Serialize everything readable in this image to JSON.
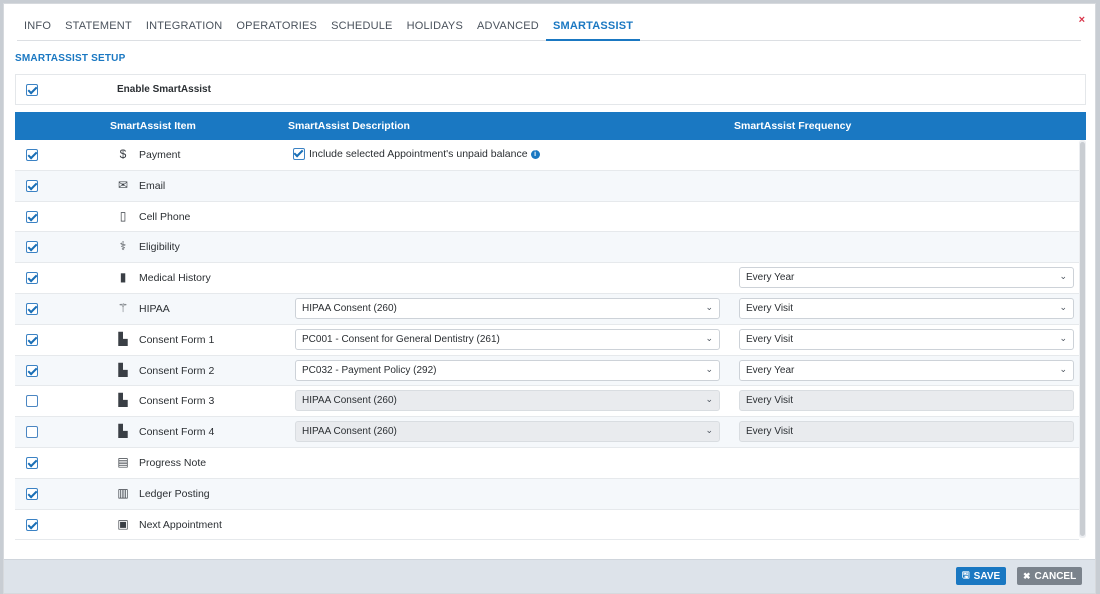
{
  "tabs": [
    "INFO",
    "STATEMENT",
    "INTEGRATION",
    "OPERATORIES",
    "SCHEDULE",
    "HOLIDAYS",
    "ADVANCED",
    "SMARTASSIST"
  ],
  "active_tab": "SMARTASSIST",
  "close_label": "×",
  "section_title": "SMARTASSIST SETUP",
  "enable": {
    "label": "Enable SmartAssist",
    "checked": true
  },
  "table_header": {
    "item": "SmartAssist Item",
    "description": "SmartAssist Description",
    "frequency": "SmartAssist Frequency"
  },
  "rows": [
    {
      "checked": true,
      "icon": "dollar-icon",
      "glyph": "$",
      "label": "Payment",
      "desc_check": {
        "label": "Include selected Appointment's unpaid balance",
        "checked": true
      }
    },
    {
      "checked": true,
      "icon": "envelope-icon",
      "glyph": "✉",
      "label": "Email"
    },
    {
      "checked": true,
      "icon": "mobile-phone-icon",
      "glyph": "▯",
      "label": "Cell Phone"
    },
    {
      "checked": true,
      "icon": "tooth-icon",
      "glyph": "⚕",
      "label": "Eligibility"
    },
    {
      "checked": true,
      "icon": "file-icon",
      "glyph": "▮",
      "label": "Medical History",
      "freq": "Every Year"
    },
    {
      "checked": true,
      "icon": "caduceus-icon",
      "glyph": "⚚",
      "label": "HIPAA",
      "desc": "HIPAA Consent (260)",
      "freq": "Every Visit"
    },
    {
      "checked": true,
      "icon": "form-icon",
      "glyph": "▙",
      "label": "Consent Form 1",
      "desc": "PC001 - Consent for General Dentistry (261)",
      "freq": "Every Visit"
    },
    {
      "checked": true,
      "icon": "form-icon",
      "glyph": "▙",
      "label": "Consent Form 2",
      "desc": "PC032 - Payment Policy (292)",
      "freq": "Every Year"
    },
    {
      "checked": false,
      "icon": "form-icon",
      "glyph": "▙",
      "label": "Consent Form 3",
      "desc": "HIPAA Consent (260)",
      "freq": "Every Visit",
      "disabled": true
    },
    {
      "checked": false,
      "icon": "form-icon",
      "glyph": "▙",
      "label": "Consent Form 4",
      "desc": "HIPAA Consent (260)",
      "freq": "Every Visit",
      "disabled": true
    },
    {
      "checked": true,
      "icon": "note-icon",
      "glyph": "▤",
      "label": "Progress Note"
    },
    {
      "checked": true,
      "icon": "ledger-icon",
      "glyph": "▥",
      "label": "Ledger Posting"
    },
    {
      "checked": true,
      "icon": "calendar-icon",
      "glyph": "▣",
      "label": "Next Appointment"
    }
  ],
  "footer": {
    "save_label": "SAVE",
    "cancel_label": "CANCEL"
  },
  "colors": {
    "accent": "#1a78c2",
    "close": "#d9344a",
    "cancel": "#7b838c"
  }
}
